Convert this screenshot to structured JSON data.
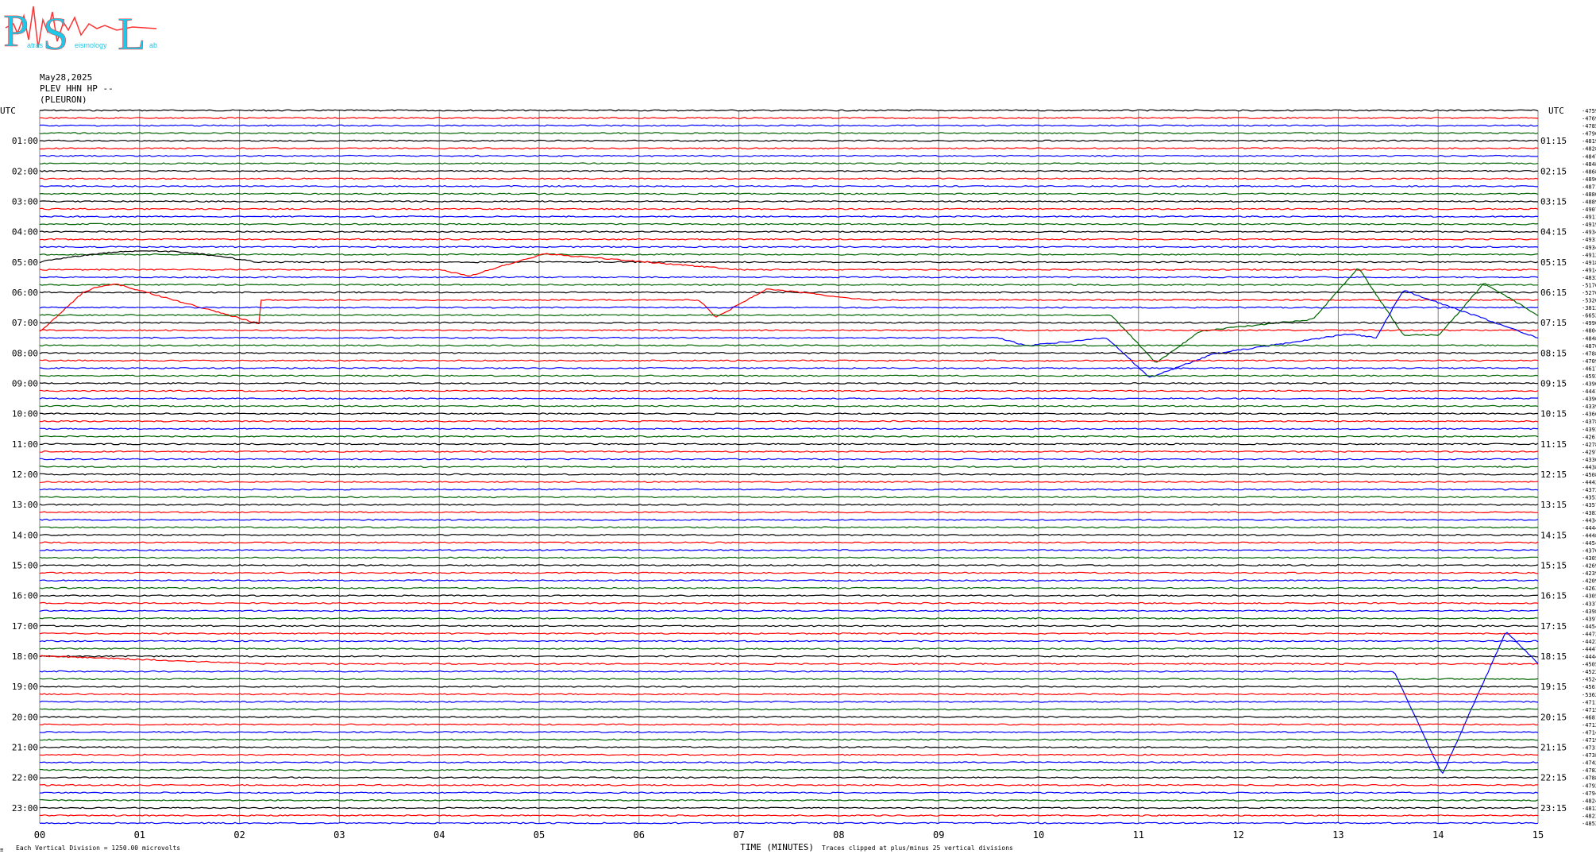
{
  "logo": {
    "text": "PSL",
    "big_letters": [
      "P",
      "S",
      "L"
    ],
    "words": [
      "atras",
      "eismology",
      "ab"
    ]
  },
  "header": {
    "date": "May28,2025",
    "station": "PLEV HHN HP --",
    "location": "(PLEURON)"
  },
  "labels": {
    "utc_left": "UTC",
    "utc_right": "UTC",
    "time_axis": "TIME (MINUTES)",
    "clip_note": "Traces clipped at plus/minus 25 vertical divisions",
    "division_note": "Each Vertical Division = 1250.00 microvolts",
    "corner_mark": "≡"
  },
  "colors": {
    "black": "#000000",
    "red": "#ff0000",
    "blue": "#0000ff",
    "green": "#006400",
    "grid": "#808080",
    "logo_cyan": "#1fc8e6",
    "logo_red": "#ff3333"
  },
  "chart_data": {
    "type": "line",
    "description_free": true,
    "xlim": [
      0,
      15
    ],
    "x_ticks": [
      "00",
      "01",
      "02",
      "03",
      "04",
      "05",
      "06",
      "07",
      "08",
      "09",
      "10",
      "11",
      "12",
      "13",
      "14",
      "15"
    ],
    "left_labels": [
      "01:00",
      "02:00",
      "03:00",
      "04:00",
      "05:00",
      "06:00",
      "07:00",
      "08:00",
      "09:00",
      "10:00",
      "11:00",
      "12:00",
      "13:00",
      "14:00",
      "15:00",
      "16:00",
      "17:00",
      "18:00",
      "19:00",
      "20:00",
      "21:00",
      "22:00",
      "23:00"
    ],
    "right_labels": [
      "01:15",
      "02:15",
      "03:15",
      "04:15",
      "05:15",
      "06:15",
      "07:15",
      "08:15",
      "09:15",
      "10:15",
      "11:15",
      "12:15",
      "13:15",
      "14:15",
      "15:15",
      "16:15",
      "17:15",
      "18:15",
      "19:15",
      "20:15",
      "21:15",
      "22:15",
      "23:15"
    ],
    "trace_colors_cycle": [
      "black",
      "red",
      "blue",
      "green"
    ],
    "offsets": [
      "-4759",
      "-4769",
      "-4785",
      "-4796",
      "-4819",
      "-4828",
      "-4847",
      "-4848",
      "-4868",
      "-4896",
      "-4871",
      "-4880",
      "-4889",
      "-4907",
      "-4911",
      "-4919",
      "-4934",
      "-4931",
      "-4934",
      "-4912",
      "-4918",
      "-4914",
      "-4833",
      "-5176",
      "-5276",
      "-5326",
      "-3813",
      "-6652",
      "-4990",
      "-4804",
      "-4848",
      "-4876",
      "-4788",
      "-4709",
      "-4617",
      "-4593",
      "-4390",
      "-4441",
      "-4396",
      "-4339",
      "-4366",
      "-4378",
      "-4393",
      "-4261",
      "-4278",
      "-4297",
      "-4336",
      "-4438",
      "-4508",
      "-4442",
      "-4372",
      "-4353",
      "-4357",
      "-4383",
      "-4434",
      "-4444",
      "-4448",
      "-4454",
      "-4376",
      "-4305",
      "-4269",
      "-4239",
      "-4209",
      "-4263",
      "-4305",
      "-4337",
      "-4398",
      "-4397",
      "-4454",
      "-4472",
      "-4423",
      "-4447",
      "-4444",
      "-4505",
      "-4522",
      "-4524",
      "-4561",
      "-5362",
      "-4711",
      "-4715",
      "-4681",
      "-4712",
      "-4714",
      "-4719",
      "-4731",
      "-4738",
      "-4742",
      "-4782",
      "-4788",
      "-4792",
      "-4794",
      "-4824",
      "-4812",
      "-4823",
      "-4852"
    ],
    "events": [
      {
        "trace": 20,
        "x": [
          0,
          2.6
        ],
        "shape": "drift_green"
      },
      {
        "trace": 21,
        "x": [
          4.0,
          7.0
        ],
        "shape": "dip_blue"
      },
      {
        "trace": 25,
        "x": [
          6.6,
          8.3
        ],
        "shape": "dip_blue2"
      },
      {
        "trace": 25,
        "x": [
          0,
          2.2
        ],
        "shape": "loop_black"
      },
      {
        "trace": 27,
        "x": [
          10.5,
          15
        ],
        "shape": "rise_green"
      },
      {
        "trace": 30,
        "x": [
          9.6,
          15
        ],
        "shape": "wave_black"
      },
      {
        "trace": 73,
        "x": [
          0,
          2.5
        ],
        "shape": "decay_blue"
      },
      {
        "trace": 74,
        "x": [
          13.4,
          15
        ],
        "shape": "dip_red"
      }
    ]
  }
}
